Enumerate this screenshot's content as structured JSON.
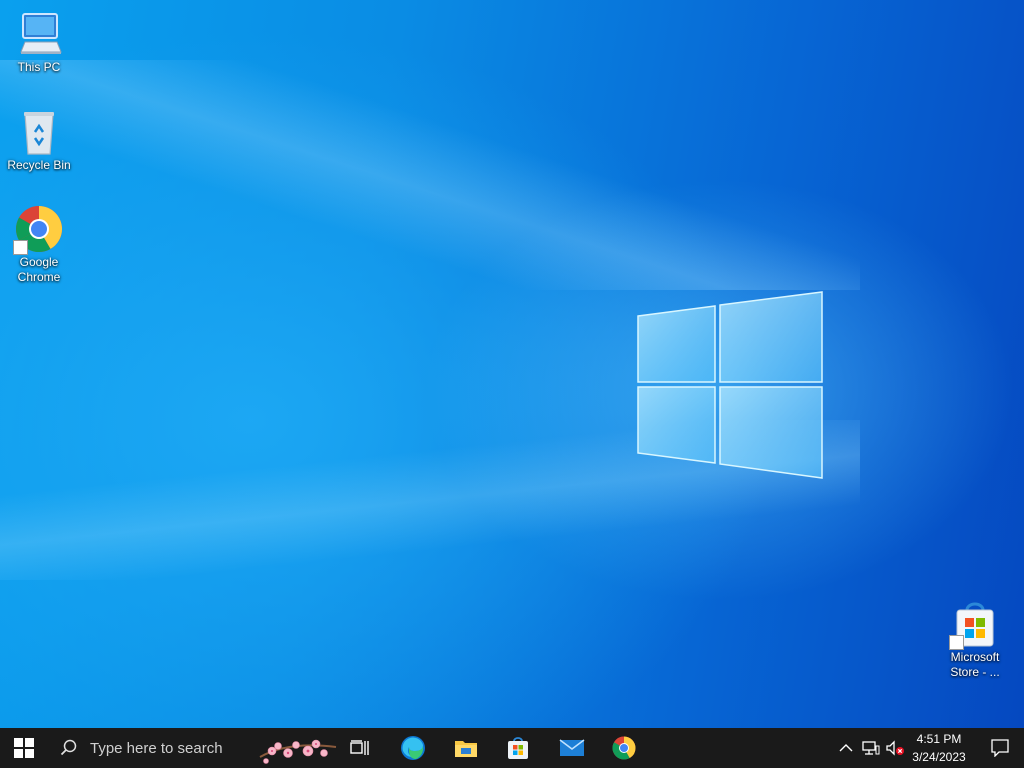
{
  "desktop": {
    "icons": [
      {
        "label": "This PC",
        "icon": "computer-icon"
      },
      {
        "label": "Recycle Bin",
        "icon": "recycle-bin-icon"
      },
      {
        "label": "Google Chrome",
        "icon": "chrome-icon"
      },
      {
        "label": "Microsoft Store - ...",
        "icon": "store-icon"
      }
    ]
  },
  "taskbar": {
    "search_placeholder": "Type here to search",
    "pinned_apps": [
      {
        "name": "Task View",
        "icon": "task-view-icon"
      },
      {
        "name": "Microsoft Edge",
        "icon": "edge-icon"
      },
      {
        "name": "File Explorer",
        "icon": "file-explorer-icon"
      },
      {
        "name": "Microsoft Store",
        "icon": "store-icon"
      },
      {
        "name": "Mail",
        "icon": "mail-icon"
      },
      {
        "name": "Google Chrome",
        "icon": "chrome-icon"
      }
    ],
    "tray": {
      "time": "4:51 PM",
      "date": "3/24/2023"
    }
  },
  "colors": {
    "taskbar_bg": "#1a1a1a",
    "desktop_accent": "#0a8ce4"
  }
}
